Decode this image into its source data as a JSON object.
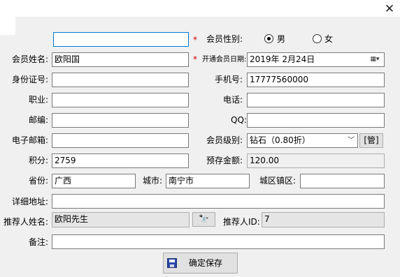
{
  "window": {
    "close_glyph": "✕"
  },
  "form": {
    "gender_label": "会员性别:",
    "gender_male": "男",
    "gender_female": "女",
    "name_label": "会员姓名:",
    "name_value": "欧阳国",
    "open_date_label": "开通会员日期:",
    "open_date_value": "2019年  2月24日",
    "id_label": "身份证号:",
    "phone_label": "手机号:",
    "phone_value": "17777560000",
    "job_label": "职业:",
    "tel_label": "电话:",
    "zip_label": "邮编:",
    "qq_label": "QQ:",
    "email_label": "电子邮箱:",
    "level_label": "会员级别:",
    "level_value": "钻石（0.80折）",
    "manage_button": "[管]",
    "points_label": "积分:",
    "points_value": "2759",
    "deposit_label": "预存金额:",
    "deposit_value": "120.00",
    "province_label": "省份:",
    "province_value": "广西",
    "city_label": "城市:",
    "city_value": "南宁市",
    "district_label": "城区镇区:",
    "address_label": "详细地址:",
    "referrer_label": "推荐人姓名:",
    "referrer_value": "欧阳先生",
    "referrer_id_label": "推荐人ID:",
    "referrer_id_value": "7",
    "note_label": "备注:",
    "save_button": "确定保存",
    "required_mark": "*"
  },
  "icons": {
    "calendar": "calendar-icon",
    "binoculars": "binoculars-icon",
    "save": "floppy-disk-icon"
  }
}
